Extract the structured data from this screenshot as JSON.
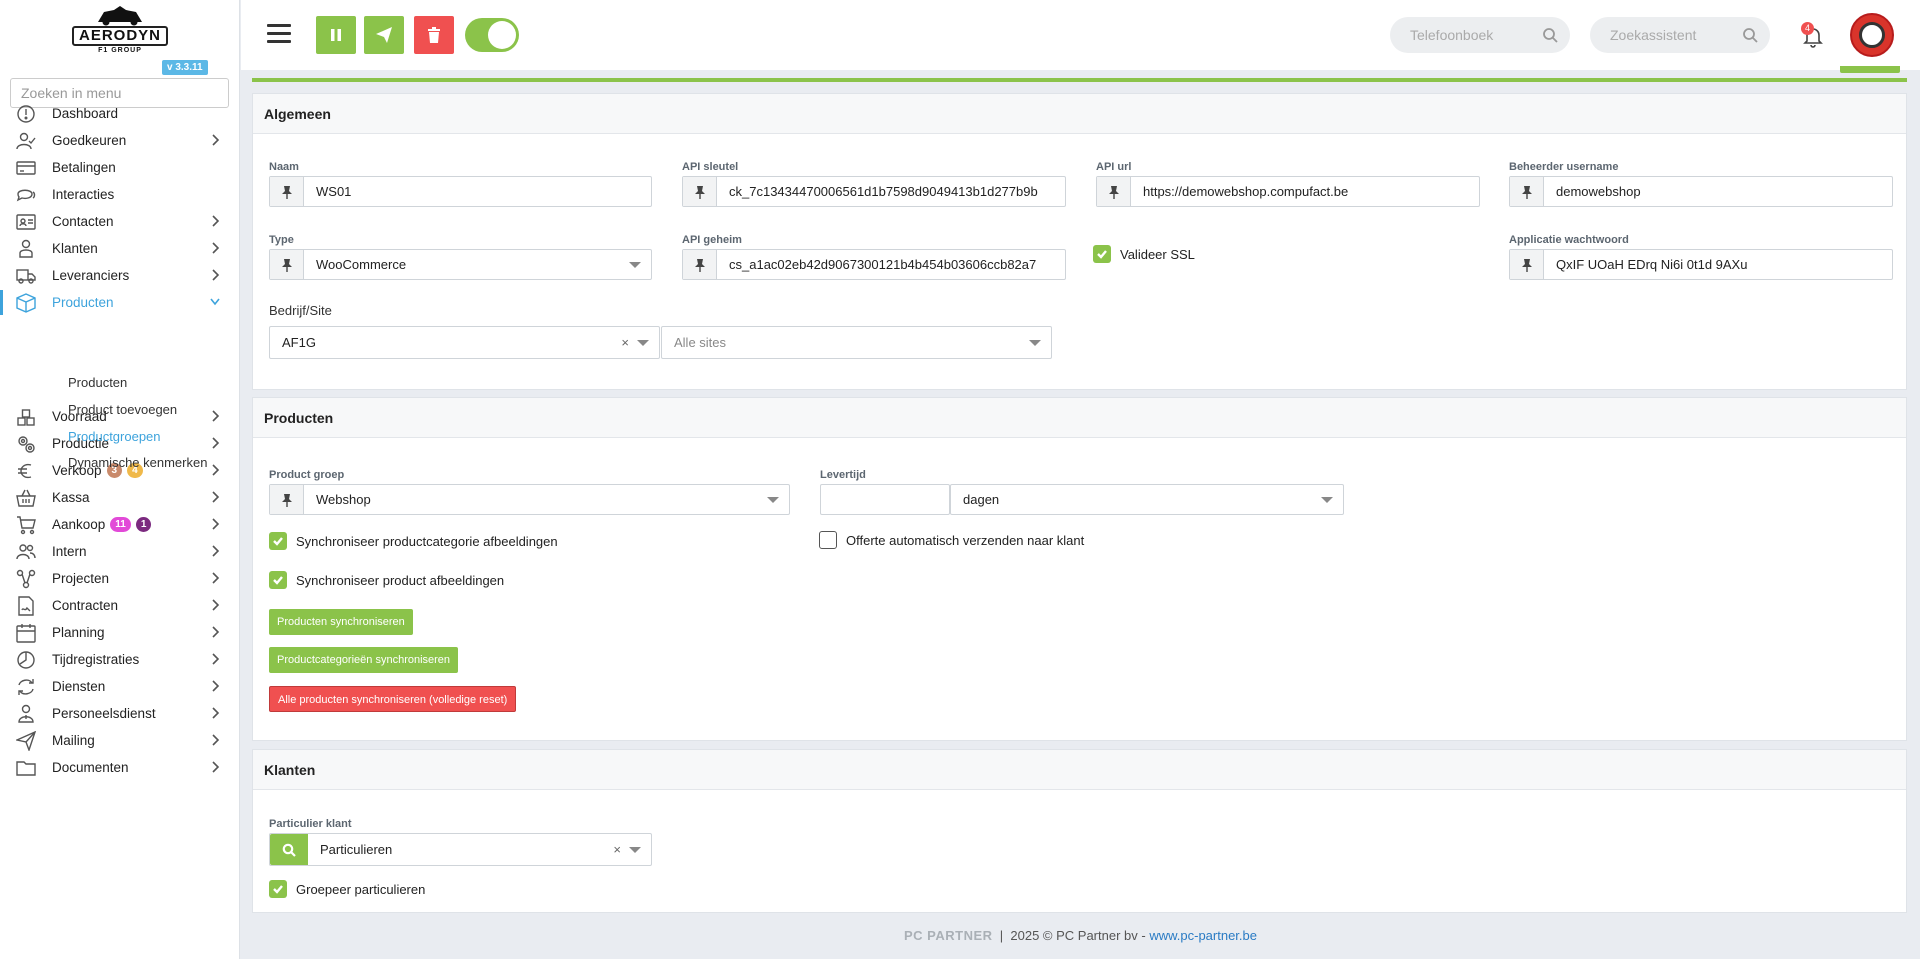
{
  "brand": {
    "logo_text": "AERODYN",
    "logo_sub": "F1 GROUP",
    "version": "v 3.3.11"
  },
  "menu_search": {
    "placeholder": "Zoeken in menu"
  },
  "menu": [
    {
      "label": "Dashboard",
      "icon": "dashboard-icon",
      "has_children": false
    },
    {
      "label": "Goedkeuren",
      "icon": "user-check-icon",
      "has_children": true
    },
    {
      "label": "Betalingen",
      "icon": "credit-card-icon",
      "has_children": false
    },
    {
      "label": "Interacties",
      "icon": "chat-icon",
      "has_children": false
    },
    {
      "label": "Contacten",
      "icon": "id-card-icon",
      "has_children": true
    },
    {
      "label": "Klanten",
      "icon": "customer-icon",
      "has_children": true
    },
    {
      "label": "Leveranciers",
      "icon": "truck-icon",
      "has_children": true
    },
    {
      "label": "Producten",
      "icon": "box-icon",
      "has_children": true,
      "active": true
    },
    {
      "label": "Voorraad",
      "icon": "stock-icon",
      "has_children": true
    },
    {
      "label": "Productie",
      "icon": "gears-icon",
      "has_children": true
    },
    {
      "label": "Verkoop",
      "icon": "euro-icon",
      "has_children": true,
      "badges": [
        {
          "text": "3",
          "color": "#c98a6b"
        },
        {
          "text": "4",
          "color": "#f0b94a"
        }
      ]
    },
    {
      "label": "Kassa",
      "icon": "basket-icon",
      "has_children": true
    },
    {
      "label": "Aankoop",
      "icon": "cart-icon",
      "has_children": true,
      "badges": [
        {
          "text": "11",
          "color": "#e24ad8"
        },
        {
          "text": "1",
          "color": "#7b2a7f"
        }
      ]
    },
    {
      "label": "Intern",
      "icon": "users-icon",
      "has_children": true
    },
    {
      "label": "Projecten",
      "icon": "project-icon",
      "has_children": true
    },
    {
      "label": "Contracten",
      "icon": "contract-icon",
      "has_children": true
    },
    {
      "label": "Planning",
      "icon": "calendar-icon",
      "has_children": true
    },
    {
      "label": "Tijdregistraties",
      "icon": "timer-icon",
      "has_children": true
    },
    {
      "label": "Diensten",
      "icon": "refresh-icon",
      "has_children": true
    },
    {
      "label": "Personeelsdienst",
      "icon": "staff-icon",
      "has_children": true
    },
    {
      "label": "Mailing",
      "icon": "send-icon",
      "has_children": true
    },
    {
      "label": "Documenten",
      "icon": "folder-icon",
      "has_children": true
    }
  ],
  "submenu": [
    {
      "label": "Producten",
      "active": false
    },
    {
      "label": "Product toevoegen",
      "active": false
    },
    {
      "label": "Productgroepen",
      "active": true
    },
    {
      "label": "Dynamische kenmerken",
      "active": false
    }
  ],
  "topbar": {
    "search_phonebook": "Telefoonboek",
    "search_assistant": "Zoekassistent",
    "notifications": "4",
    "colors": {
      "green": "#8bc34a",
      "red": "#f05050"
    }
  },
  "algemeen": {
    "title": "Algemeen",
    "naam": {
      "label": "Naam",
      "value": "WS01"
    },
    "api_key": {
      "label": "API sleutel",
      "value": "ck_7c13434470006561d1b7598d9049413b1d277b9b"
    },
    "api_url": {
      "label": "API url",
      "value": "https://demowebshop.compufact.be"
    },
    "admin_user": {
      "label": "Beheerder username",
      "value": "demowebshop"
    },
    "type": {
      "label": "Type",
      "value": "WooCommerce"
    },
    "api_secret": {
      "label": "API geheim",
      "value": "cs_a1ac02eb42d9067300121b4b454b03606ccb82a7"
    },
    "validate_ssl": {
      "label": "Valideer SSL",
      "checked": true
    },
    "app_password": {
      "label": "Applicatie wachtwoord",
      "value": "QxIF UOaH EDrq Ni6i 0t1d 9AXu"
    },
    "company_site": {
      "label": "Bedrijf/Site",
      "company": "AF1G",
      "site_placeholder": "Alle sites"
    }
  },
  "producten": {
    "title": "Producten",
    "product_group": {
      "label": "Product groep",
      "value": "Webshop"
    },
    "lead_time": {
      "label": "Levertijd",
      "value": "",
      "unit": "dagen"
    },
    "sync_cat_images": {
      "label": "Synchroniseer productcategorie afbeeldingen",
      "checked": true
    },
    "auto_quote": {
      "label": "Offerte automatisch verzenden naar klant",
      "checked": false
    },
    "sync_prod_images": {
      "label": "Synchroniseer product afbeeldingen",
      "checked": true
    },
    "btn_sync_products": "Producten synchroniseren",
    "btn_sync_categories": "Productcategorieën synchroniseren",
    "btn_full_reset": "Alle producten synchroniseren (volledige reset)"
  },
  "klanten": {
    "title": "Klanten",
    "private_customer": {
      "label": "Particulier klant",
      "value": "Particulieren"
    },
    "group_private": {
      "label": "Groepeer particulieren",
      "checked": true
    }
  },
  "footer": {
    "brand": "PC PARTNER",
    "copyright": "2025 © PC Partner bv -",
    "link": "www.pc-partner.be"
  }
}
